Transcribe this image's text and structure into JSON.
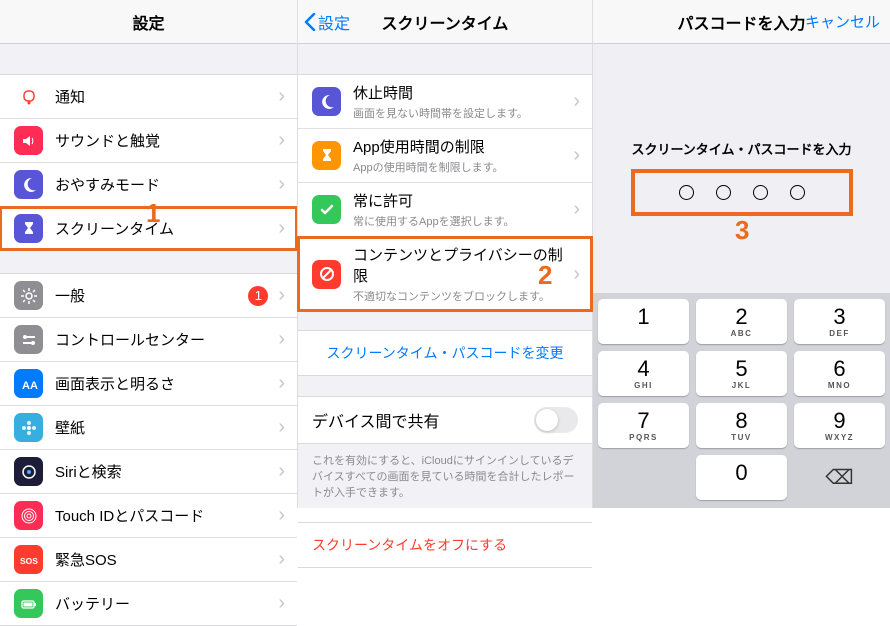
{
  "col1": {
    "title": "設定",
    "annot": "1",
    "groups": [
      {
        "items": [
          {
            "icon": "bell",
            "color": "#ff3b30",
            "label": "通知",
            "outline": true
          },
          {
            "icon": "speaker",
            "color": "#ff2d55",
            "label": "サウンドと触覚"
          },
          {
            "icon": "moon",
            "color": "#5856d6",
            "label": "おやすみモード"
          },
          {
            "icon": "hourglass",
            "color": "#5856d6",
            "label": "スクリーンタイム",
            "hl": true
          }
        ]
      },
      {
        "items": [
          {
            "icon": "gear",
            "color": "#8e8e93",
            "label": "一般",
            "badge": "1"
          },
          {
            "icon": "switches",
            "color": "#8e8e93",
            "label": "コントロールセンター"
          },
          {
            "icon": "aa",
            "color": "#007aff",
            "label": "画面表示と明るさ"
          },
          {
            "icon": "flower",
            "color": "#36aee0",
            "label": "壁紙"
          },
          {
            "icon": "siri",
            "color": "#1d1d3a",
            "label": "Siriと検索"
          },
          {
            "icon": "touch",
            "color": "#ff2d55",
            "label": "Touch IDとパスコード"
          },
          {
            "icon": "sos",
            "color": "#ff3b30",
            "label": "緊急SOS"
          },
          {
            "icon": "battery",
            "color": "#34c759",
            "label": "バッテリー"
          }
        ]
      }
    ]
  },
  "col2": {
    "back": "設定",
    "title": "スクリーンタイム",
    "annot": "2",
    "items": [
      {
        "icon": "moon",
        "color": "#5856d6",
        "label": "休止時間",
        "sub": "画面を見ない時間帯を設定します。"
      },
      {
        "icon": "hourglass",
        "color": "#ff9500",
        "label": "App使用時間の制限",
        "sub": "Appの使用時間を制限します。"
      },
      {
        "icon": "check",
        "color": "#34c759",
        "label": "常に許可",
        "sub": "常に使用するAppを選択します。"
      },
      {
        "icon": "block",
        "color": "#ff3b30",
        "label": "コンテンツとプライバシーの制限",
        "sub": "不適切なコンテンツをブロックします。",
        "hl": true
      }
    ],
    "changePass": "スクリーンタイム・パスコードを変更",
    "shareLabel": "デバイス間で共有",
    "shareNote": "これを有効にすると、iCloudにサインインしているデバイスすべての画面を見ている時間を合計したレポートが入手できます。",
    "off": "スクリーンタイムをオフにする"
  },
  "col3": {
    "title": "パスコードを入力",
    "cancel": "キャンセル",
    "instr": "スクリーンタイム・パスコードを入力",
    "annot": "3",
    "keys": [
      {
        "n": "1",
        "l": ""
      },
      {
        "n": "2",
        "l": "ABC"
      },
      {
        "n": "3",
        "l": "DEF"
      },
      {
        "n": "4",
        "l": "GHI"
      },
      {
        "n": "5",
        "l": "JKL"
      },
      {
        "n": "6",
        "l": "MNO"
      },
      {
        "n": "7",
        "l": "PQRS"
      },
      {
        "n": "8",
        "l": "TUV"
      },
      {
        "n": "9",
        "l": "WXYZ"
      },
      {
        "blank": true
      },
      {
        "n": "0",
        "l": ""
      },
      {
        "bksp": true
      }
    ]
  }
}
